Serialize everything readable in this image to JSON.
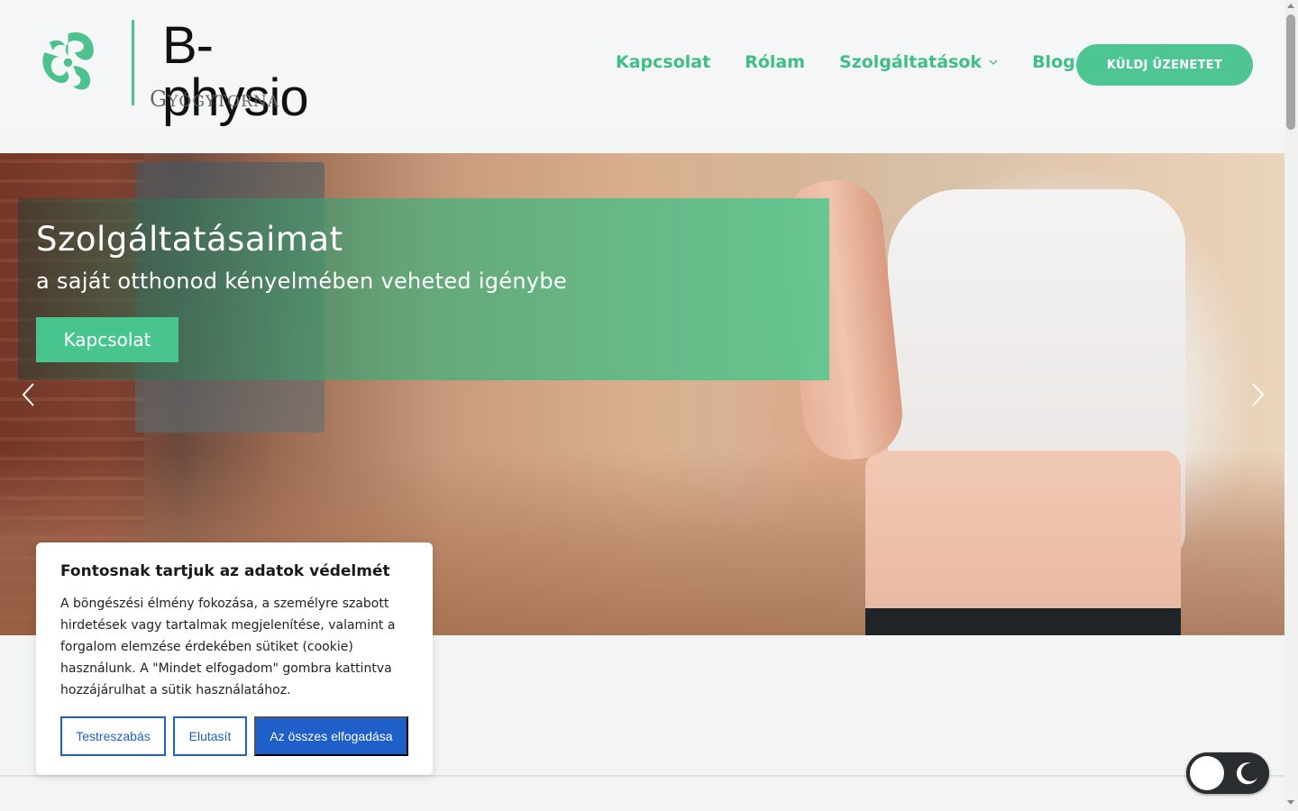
{
  "brand": {
    "name": "B-physio",
    "tagline": "Gyógytorna",
    "logo_icon": "physio-swirl-logo-icon",
    "accent_color": "#4ec694"
  },
  "nav": {
    "items": [
      {
        "label": "Kapcsolat"
      },
      {
        "label": "Rólam"
      },
      {
        "label": "Szolgáltatások",
        "has_dropdown": true
      },
      {
        "label": "Blog"
      }
    ],
    "cta_label": "KÜLDJ ÜZENETET"
  },
  "hero": {
    "title": "Szolgáltatásaimat",
    "subtitle": "a saját otthonod kényelmében veheted igénybe",
    "button_label": "Kapcsolat",
    "prev_icon": "chevron-left-icon",
    "next_icon": "chevron-right-icon"
  },
  "cookie": {
    "title": "Fontosnak tartjuk az adatok védelmét",
    "text": "A böngészési élmény fokozása, a személyre szabott hirdetések vagy tartalmak megjelenítése, valamint a forgalom elemzése érdekében sütiket (cookie) használunk. A \"Mindet elfogadom\" gombra kattintva hozzájárulhat a sütik használatához.",
    "customize_label": "Testreszabás",
    "reject_label": "Elutasít",
    "accept_all_label": "Az összes elfogadása",
    "button_color": "#1e5fc9"
  },
  "theme_toggle": {
    "icon": "moon-icon",
    "state": "light"
  }
}
